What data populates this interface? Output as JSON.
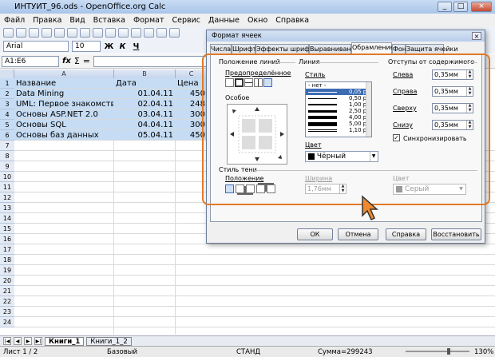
{
  "window": {
    "title": "ИНТУИТ_96.ods - OpenOffice.org Calc"
  },
  "menu": [
    "Файл",
    "Правка",
    "Вид",
    "Вставка",
    "Формат",
    "Сервис",
    "Данные",
    "Окно",
    "Справка"
  ],
  "format_bar": {
    "font": "Arial",
    "size": "10",
    "bold": "Ж",
    "italic": "К",
    "underline": "Ч"
  },
  "formula_bar": {
    "cell_ref": "A1:E6",
    "fx": "fx",
    "sigma": "Σ",
    "eq": "="
  },
  "columns": [
    "A",
    "B",
    "C"
  ],
  "rows": [
    "1",
    "2",
    "3",
    "4",
    "5",
    "6",
    "7",
    "8",
    "9",
    "10",
    "11",
    "12",
    "13",
    "14",
    "15",
    "16",
    "17",
    "18",
    "19",
    "20",
    "21",
    "22",
    "23",
    "24"
  ],
  "table": [
    [
      "Название",
      "Дата",
      "Цена"
    ],
    [
      "Data Mining",
      "01.04.11",
      "450"
    ],
    [
      "UML: Первое знакомство",
      "02.04.11",
      "248"
    ],
    [
      "Основы ASP.NET 2.0",
      "03.04.11",
      "300"
    ],
    [
      "Основы SQL",
      "04.04.11",
      "300"
    ],
    [
      "Основы баз данных",
      "05.04.11",
      "450"
    ]
  ],
  "sheet_tabs": [
    "Книги_1",
    "Книги_1_2"
  ],
  "status": {
    "sheet": "Лист 1 / 2",
    "style": "Базовый",
    "mode": "СТАНД",
    "sum": "Сумма=299243",
    "zoom": "130%"
  },
  "dialog": {
    "title": "Формат ячеек",
    "close": "×",
    "tabs": [
      "Числа",
      "Шрифт",
      "Эффекты шрифта",
      "Выравнивание",
      "Обрамление",
      "Фон",
      "Защита ячейки"
    ],
    "active_tab": "Обрамление",
    "line_position": {
      "heading": "Положение линий",
      "predefined": "Предопределённое",
      "custom": "Особое"
    },
    "line": {
      "heading": "Линия",
      "style_label": "Стиль",
      "styles": [
        "- нет -",
        "0,05 pt",
        "0,50 pt",
        "1,00 pt",
        "2,50 pt",
        "4,00 pt",
        "5,00 pt",
        "1,10 pt"
      ],
      "selected": "0,05 pt",
      "color_label": "Цвет",
      "color_value": "Чёрный"
    },
    "padding": {
      "heading": "Отступы от содержимого",
      "left_label": "Слева",
      "left": "0,35мм",
      "right_label": "Справа",
      "right": "0,35мм",
      "top_label": "Сверху",
      "top": "0,35мм",
      "bottom_label": "Снизу",
      "bottom": "0,35мм",
      "sync_label": "Синхронизировать"
    },
    "shadow": {
      "heading": "Стиль тени",
      "position_label": "Положение",
      "width_label": "Ширина",
      "width": "1,76мм",
      "color_label": "Цвет",
      "color": "Серый"
    },
    "buttons": {
      "ok": "ОК",
      "cancel": "Отмена",
      "help": "Справка",
      "reset": "Восстановить"
    }
  }
}
